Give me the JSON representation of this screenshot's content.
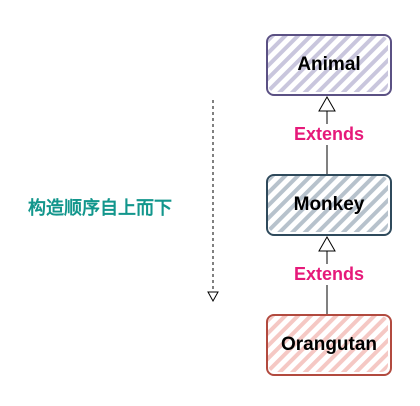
{
  "side_label": "构造顺序自上而下",
  "classes": [
    {
      "name": "Animal",
      "stroke": "#5b5184",
      "fill": "#c9c6dd"
    },
    {
      "name": "Monkey",
      "stroke": "#2f4a5c",
      "fill": "#b7c2cc"
    },
    {
      "name": "Orangutan",
      "stroke": "#b24a3f",
      "fill": "#f5c8c4"
    }
  ],
  "relations": [
    {
      "label": "Extends"
    },
    {
      "label": "Extends"
    }
  ]
}
